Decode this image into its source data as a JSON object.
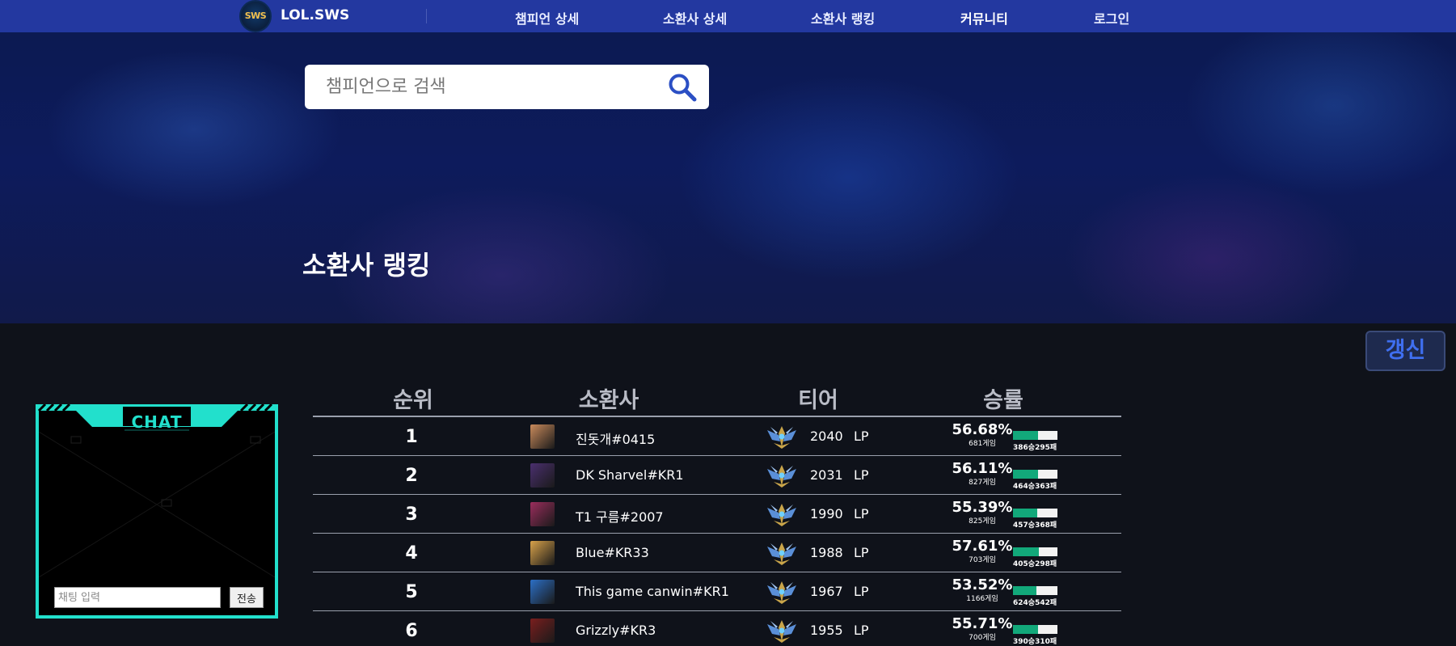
{
  "nav": {
    "logo_text": "SWS",
    "brand": "LOL.SWS",
    "items": [
      {
        "label": "챔피언 상세"
      },
      {
        "label": "소환사 상세"
      },
      {
        "label": "소환사 랭킹"
      },
      {
        "label": "커뮤니티"
      },
      {
        "label": "로그인"
      }
    ]
  },
  "search": {
    "placeholder": "챔피언으로 검색",
    "value": ""
  },
  "page_title": "소환사 랭킹",
  "refresh_label": "갱신",
  "chat": {
    "title": "CHAT",
    "input_placeholder": "채팅 입력",
    "send_label": "전송"
  },
  "table": {
    "headers": [
      "순위",
      "소환사",
      "티어",
      "승률"
    ],
    "lp_unit": "LP",
    "rows": [
      {
        "rank": "1",
        "name": "진돗개#0415",
        "lp": "2040",
        "winrate": "56.68%",
        "games": "681게임",
        "wl": "386승295패",
        "win_ratio": 0.5668,
        "avatar_color": "#c98a5b"
      },
      {
        "rank": "2",
        "name": "DK Sharvel#KR1",
        "lp": "2031",
        "winrate": "56.11%",
        "games": "827게임",
        "wl": "464승363패",
        "win_ratio": 0.5611,
        "avatar_color": "#4a2f6e"
      },
      {
        "rank": "3",
        "name": "T1 구름#2007",
        "lp": "1990",
        "winrate": "55.39%",
        "games": "825게임",
        "wl": "457승368패",
        "win_ratio": 0.5539,
        "avatar_color": "#9a2d5c"
      },
      {
        "rank": "4",
        "name": "Blue#KR33",
        "lp": "1988",
        "winrate": "57.61%",
        "games": "703게임",
        "wl": "405승298패",
        "win_ratio": 0.5761,
        "avatar_color": "#d8a24a"
      },
      {
        "rank": "5",
        "name": "This game canwin#KR1",
        "lp": "1967",
        "winrate": "53.52%",
        "games": "1166게임",
        "wl": "624승542패",
        "win_ratio": 0.5352,
        "avatar_color": "#2c6fc6"
      },
      {
        "rank": "6",
        "name": "Grizzly#KR3",
        "lp": "1955",
        "winrate": "55.71%",
        "games": "700게임",
        "wl": "390승310패",
        "win_ratio": 0.5571,
        "avatar_color": "#7a1e1e"
      }
    ]
  },
  "colors": {
    "nav_bg": "#2338a0",
    "accent_teal": "#22e0cc",
    "win_green": "#12a87a",
    "refresh_text": "#3f6ff0"
  }
}
